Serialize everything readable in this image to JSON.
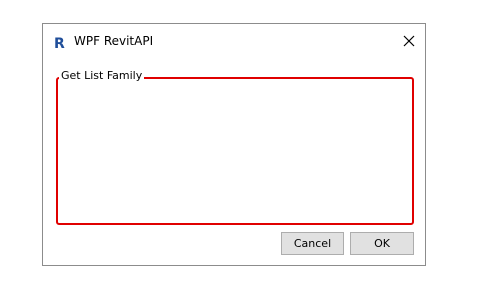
{
  "window": {
    "title": "WPF RevitAPI",
    "app_icon": "revit-r-icon"
  },
  "group": {
    "legend": "Get List Family",
    "border_color": "#e00000"
  },
  "buttons": {
    "cancel_label": "Cancel",
    "ok_label": "OK"
  },
  "colors": {
    "button_bg": "#e1e1e1",
    "button_border": "#adadad"
  }
}
